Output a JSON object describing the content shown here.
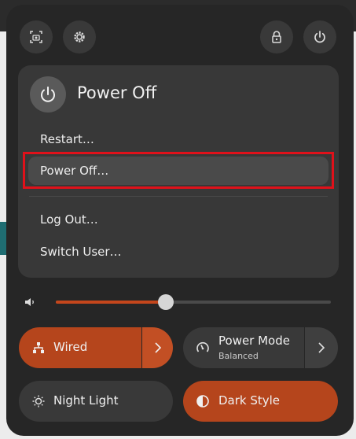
{
  "top_buttons": {
    "screenshot": "screenshot-icon",
    "settings": "gear-icon",
    "lock": "lock-icon",
    "power": "power-icon"
  },
  "menu": {
    "title": "Power Off",
    "items": [
      {
        "label": "Restart…"
      },
      {
        "label": "Power Off…"
      },
      {
        "label": "Log Out…"
      },
      {
        "label": "Switch User…"
      }
    ]
  },
  "volume": {
    "level": 0.4
  },
  "tiles": {
    "wired": {
      "label": "Wired",
      "active": true
    },
    "power_mode": {
      "label": "Power Mode",
      "sub": "Balanced",
      "active": false
    },
    "night_light": {
      "label": "Night Light",
      "active": false
    },
    "dark_style": {
      "label": "Dark Style",
      "active": true
    }
  },
  "colors": {
    "accent": "#b5451c",
    "panel": "#262626",
    "menu": "#383838"
  }
}
